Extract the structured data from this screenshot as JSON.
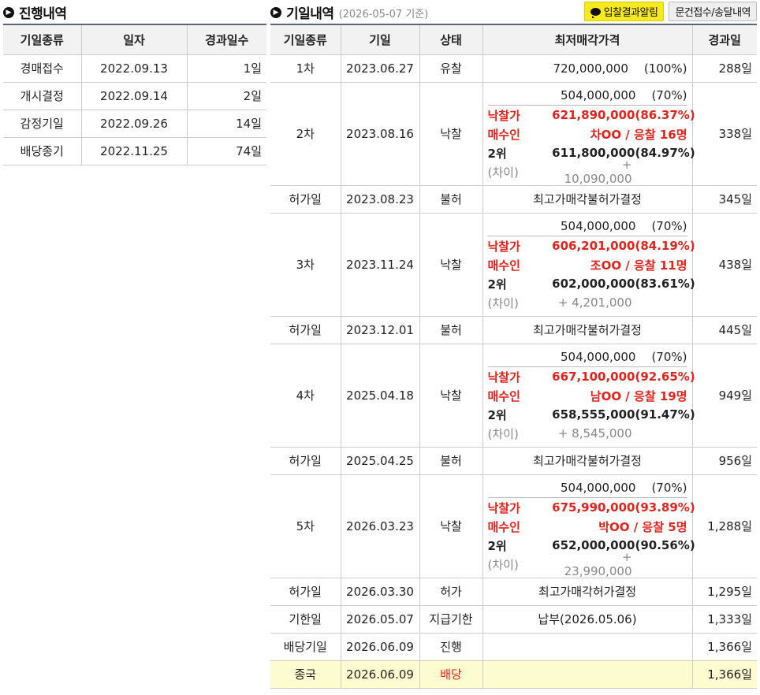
{
  "left": {
    "title": "진행내역",
    "headers": [
      "기일종류",
      "일자",
      "경과일수"
    ],
    "rows": [
      {
        "type": "경매접수",
        "date": "2022.09.13",
        "days": "1일"
      },
      {
        "type": "개시결정",
        "date": "2022.09.14",
        "days": "2일"
      },
      {
        "type": "감정기일",
        "date": "2022.09.26",
        "days": "14일"
      },
      {
        "type": "배당종기",
        "date": "2022.11.25",
        "days": "74일"
      }
    ]
  },
  "right": {
    "title": "기일내역",
    "subtitle": "(2026-05-07 기준)",
    "buttons": {
      "notify": "입찰결과알림",
      "docs": "문건접수/송달내역"
    },
    "headers": [
      "기일종류",
      "기일",
      "상태",
      "최저매각가격",
      "경과일"
    ],
    "labels": {
      "winning": "낙찰가",
      "buyer": "매수인",
      "second": "2위",
      "diff": "(차이)"
    },
    "rows": [
      {
        "kind": "simple",
        "type": "1차",
        "date": "2023.06.27",
        "status": "유찰",
        "min_price": "720,000,000",
        "min_pct": "(100%)",
        "days": "288일"
      },
      {
        "kind": "sale",
        "type": "2차",
        "date": "2023.08.16",
        "status": "낙찰",
        "min_price": "504,000,000",
        "min_pct": "(70%)",
        "win_price": "621,890,000",
        "win_pct": "(86.37%)",
        "buyer": "차OO / 응찰 16명",
        "second_price": "611,800,000",
        "second_pct": "(84.97%)",
        "diff": "+ 10,090,000",
        "days": "338일"
      },
      {
        "kind": "text",
        "type": "허가일",
        "date": "2023.08.23",
        "status": "불허",
        "text": "최고가매각불허가결정",
        "days": "345일"
      },
      {
        "kind": "sale",
        "type": "3차",
        "date": "2023.11.24",
        "status": "낙찰",
        "min_price": "504,000,000",
        "min_pct": "(70%)",
        "win_price": "606,201,000",
        "win_pct": "(84.19%)",
        "buyer": "조OO / 응찰 11명",
        "second_price": "602,000,000",
        "second_pct": "(83.61%)",
        "diff": "+ 4,201,000",
        "days": "438일"
      },
      {
        "kind": "text",
        "type": "허가일",
        "date": "2023.12.01",
        "status": "불허",
        "text": "최고가매각불허가결정",
        "days": "445일"
      },
      {
        "kind": "sale",
        "type": "4차",
        "date": "2025.04.18",
        "status": "낙찰",
        "min_price": "504,000,000",
        "min_pct": "(70%)",
        "win_price": "667,100,000",
        "win_pct": "(92.65%)",
        "buyer": "남OO / 응찰 19명",
        "second_price": "658,555,000",
        "second_pct": "(91.47%)",
        "diff": "+ 8,545,000",
        "days": "949일"
      },
      {
        "kind": "text",
        "type": "허가일",
        "date": "2025.04.25",
        "status": "불허",
        "text": "최고가매각불허가결정",
        "days": "956일"
      },
      {
        "kind": "sale",
        "type": "5차",
        "date": "2026.03.23",
        "status": "낙찰",
        "min_price": "504,000,000",
        "min_pct": "(70%)",
        "win_price": "675,990,000",
        "win_pct": "(93.89%)",
        "buyer": "박OO / 응찰 5명",
        "second_price": "652,000,000",
        "second_pct": "(90.56%)",
        "diff": "+ 23,990,000",
        "days": "1,288일"
      },
      {
        "kind": "text",
        "type": "허가일",
        "date": "2026.03.30",
        "status": "허가",
        "text": "최고가매각허가결정",
        "days": "1,295일"
      },
      {
        "kind": "text",
        "type": "기한일",
        "date": "2026.05.07",
        "status": "지급기한",
        "text": "납부(2026.05.06)",
        "days": "1,333일"
      },
      {
        "kind": "text",
        "type": "배당기일",
        "date": "2026.06.09",
        "status": "진행",
        "text": "",
        "days": "1,366일"
      },
      {
        "kind": "final",
        "type": "종국",
        "date": "2026.06.09",
        "status": "배당",
        "text": "",
        "days": "1,366일"
      }
    ]
  },
  "colors": {
    "accent_red": "#e3231b",
    "header_border": "#5a6472",
    "button_yellow": "#f6ea1e",
    "final_row_bg": "#fdfcd0"
  }
}
